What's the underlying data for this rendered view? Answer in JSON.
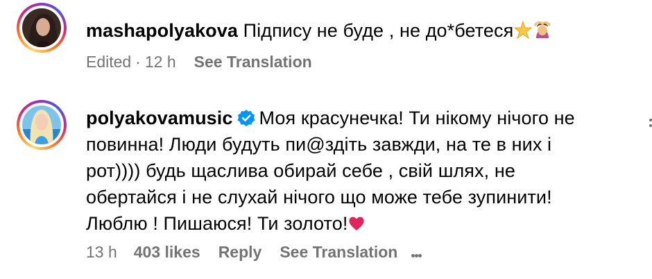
{
  "comments": [
    {
      "username": "mashapolyakova",
      "text": "Підпису не буде , не до*бетеся",
      "meta": {
        "edited": "Edited",
        "separator": "·",
        "time": "12 h",
        "see_translation": "See Translation"
      },
      "emoji": [
        "star-emoji",
        "woman-gesturing-ok-emoji"
      ]
    },
    {
      "username": "polyakovamusic",
      "verified": true,
      "lines": [
        "Моя красунечка! Ти нікому нічого не",
        "повинна! Люди будуть пи@здіть завжди, на те в них і",
        "рот)))) будь щаслива обирай себе , свій шлях, не",
        "обертайся і не слухай нічого що може тебе зупинити!",
        "Люблю ! Пишаюся! Ти золото!"
      ],
      "meta": {
        "time": "13 h",
        "likes": "403 likes",
        "reply": "Reply",
        "see_translation": "See Translation"
      },
      "emoji": [
        "red-heart-emoji"
      ]
    }
  ],
  "colors": {
    "meta_text": "#737373",
    "verified_blue": "#0095f6",
    "heart_red": "#e0245e"
  }
}
